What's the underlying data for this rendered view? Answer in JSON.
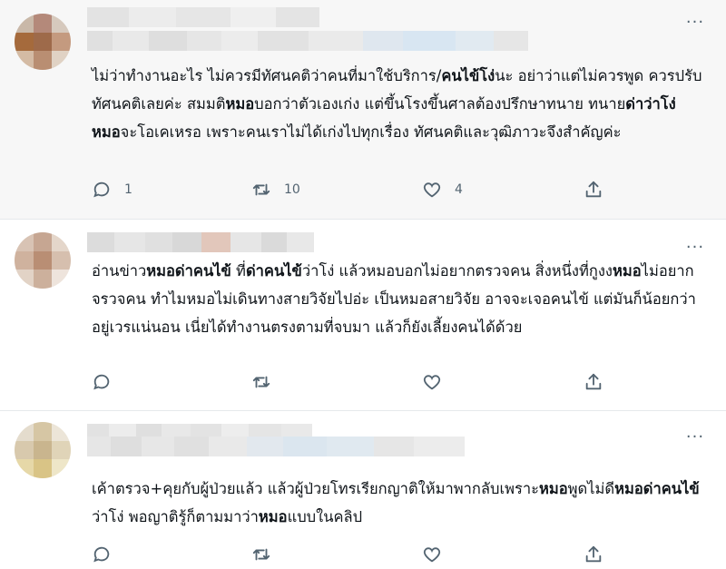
{
  "tweets": [
    {
      "text_parts": [
        {
          "t": "ไม่ว่าทำงานอะไร ไม่ควรมีทัศนคติว่าคนที่มาใช้บริการ/"
        },
        {
          "t": "คนไข้โง่",
          "b": true
        },
        {
          "t": "นะ อย่าว่าแต่ไม่ควรพูด ควรปรับทัศนคติเลยค่ะ สมมติ"
        },
        {
          "t": "หมอ",
          "b": true
        },
        {
          "t": "บอกว่าตัวเองเก่ง แต่ขึ้นโรงขึ้นศาลต้องปรึกษาทนาย ทนาย"
        },
        {
          "t": "ด่าว่าโง่",
          "b": true
        },
        {
          "t": " "
        },
        {
          "t": "หมอ",
          "b": true
        },
        {
          "t": "จะโอเคเหรอ เพราะคนเราไม่ได้เก่งไปทุกเรื่อง ทัศนคติและวุฒิภาวะจึงสำคัญค่ะ"
        }
      ],
      "reply_count": "1",
      "retweet_count": "10",
      "like_count": "4"
    },
    {
      "text_parts": [
        {
          "t": "อ่านข่าว"
        },
        {
          "t": "หมอด่าคนไข้",
          "b": true
        },
        {
          "t": " ที่"
        },
        {
          "t": "ด่าคนไข้",
          "b": true
        },
        {
          "t": "ว่าโง่ แล้วหมอบอกไม่อยากตรวจคน สิ่งหนึ่งที่กูงง"
        },
        {
          "t": "หมอ",
          "b": true
        },
        {
          "t": "ไม่อยากจรวจคน ทำไมหมอไม่เดินทางสายวิจัยไปอ่ะ เป็นหมอสายวิจัย อาจจะเจอคนไข้ แต่มันก็น้อยกว่าอยู่เวรแน่นอน เนี่ยได้ทำงานตรงตามที่จบมา แล้วก็ยังเลี้ยงคนได้ด้วย"
        }
      ],
      "reply_count": "",
      "retweet_count": "",
      "like_count": ""
    },
    {
      "text_parts": [
        {
          "t": "เค้าตรวจ+คุยกับผู้ป่วยแล้ว  แล้วผู้ป่วยโทรเรียกญาติให้มาพากลับเพราะ"
        },
        {
          "t": "หมอ",
          "b": true
        },
        {
          "t": "พูดไม่ดี"
        },
        {
          "t": "หมอด่าคนไข้",
          "b": true
        },
        {
          "t": "ว่าโง่ พอญาติรู้ก็ตามมาว่า"
        },
        {
          "t": "หมอ",
          "b": true
        },
        {
          "t": "แบบในคลิป"
        }
      ],
      "reply_count": "",
      "retweet_count": "",
      "like_count": ""
    }
  ],
  "icons": {
    "reply": "reply-icon",
    "retweet": "retweet-icon",
    "like": "heart-icon",
    "share": "share-icon",
    "more": "more-icon"
  },
  "colors": {
    "icon_gray": "#536471",
    "text": "#0f1419",
    "highlight_bg": "#f7f7f7",
    "divider": "#e6e9eb"
  }
}
